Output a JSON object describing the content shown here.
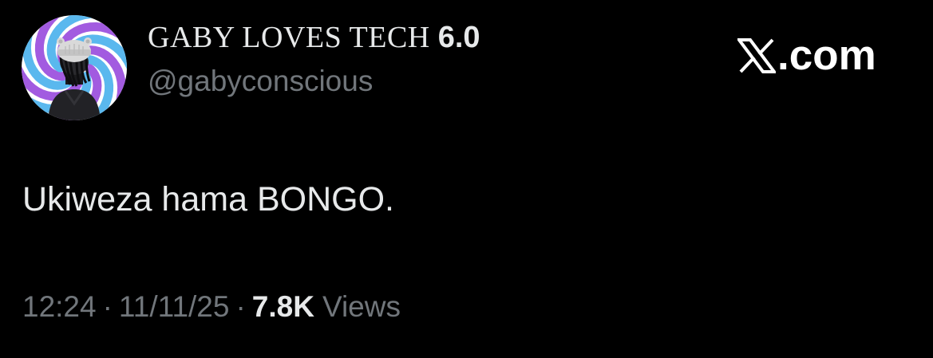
{
  "author": {
    "display_name": "GABY LOVES TECH",
    "display_name_suffix": "6.0",
    "handle": "@gabyconscious",
    "avatar": "avatar-image"
  },
  "watermark": {
    "logo": "x-logo-icon",
    "text": ".com"
  },
  "tweet": {
    "text": "Ukiweza hama BONGO."
  },
  "meta": {
    "time": "12:24",
    "separator": "·",
    "date": "11/11/25",
    "views_count": "7.8K",
    "views_label": "Views"
  },
  "colors": {
    "background": "#000000",
    "primary_text": "#e7e9ea",
    "secondary_text": "#71767b",
    "avatar_spiral_purple": "#a25be0",
    "avatar_spiral_blue": "#5ab8ee"
  }
}
